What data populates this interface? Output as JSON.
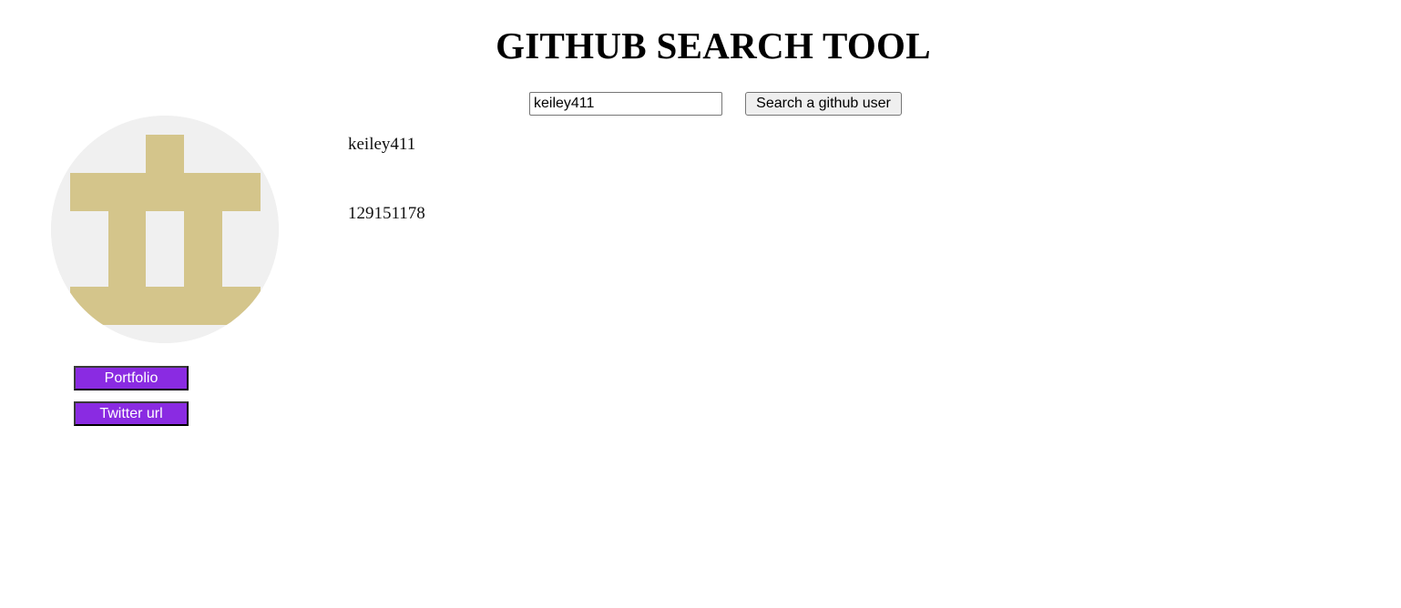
{
  "header": {
    "title": "GITHUB SEARCH TOOL"
  },
  "search": {
    "value": "keiley411",
    "button_label": "Search a github user"
  },
  "profile": {
    "avatar_icon": "identicon-avatar",
    "avatar_colors": {
      "background": "#f0f0f0",
      "foreground": "#d4c58b"
    },
    "username": "keiley411",
    "user_id": "129151178"
  },
  "links": {
    "portfolio_label": "Portfolio",
    "twitter_label": "Twitter url",
    "button_color": "#8a2be2"
  }
}
